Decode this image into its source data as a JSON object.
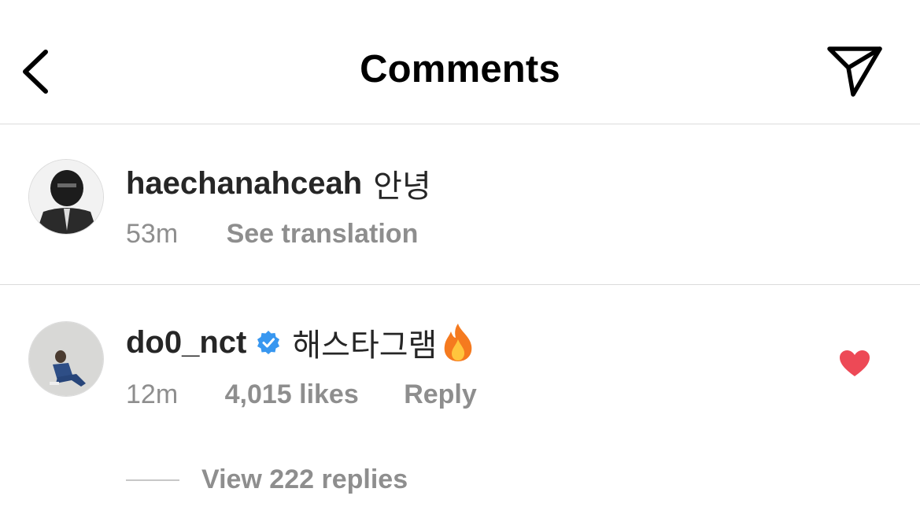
{
  "header": {
    "title": "Comments",
    "back_icon": "chevron-left-icon",
    "share_icon": "paper-plane-icon"
  },
  "comments": [
    {
      "username": "haechanahceah",
      "text": "안녕",
      "time": "53m",
      "action": "See translation",
      "avatar": "helmet-figure-avatar"
    },
    {
      "username": "do0_nct",
      "verified": true,
      "text": "해스타그램",
      "emoji": "fire-icon",
      "time": "12m",
      "likes": "4,015 likes",
      "reply_label": "Reply",
      "liked": true,
      "view_replies": "View 222 replies",
      "avatar": "seated-person-avatar"
    }
  ],
  "colors": {
    "text": "#262626",
    "secondary": "#8e8e8e",
    "divider": "#dbdbdb",
    "verified": "#3897f0",
    "heart": "#ed4956"
  }
}
